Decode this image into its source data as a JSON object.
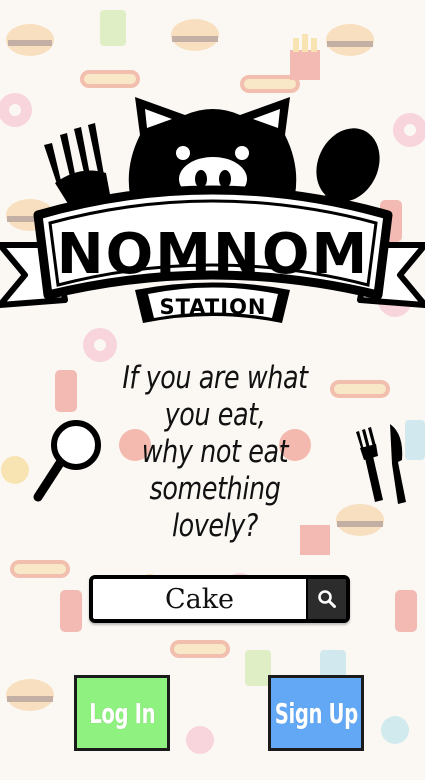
{
  "brand": {
    "name": "NOMNOM",
    "subtitle": "STATION"
  },
  "tagline": {
    "lines": [
      "If you are what",
      "you eat,",
      "why not eat",
      "something lovely?"
    ]
  },
  "search": {
    "value": "Cake"
  },
  "buttons": {
    "login_label": "Log In",
    "signup_label": "Sign Up"
  },
  "colors": {
    "login": "#8ff17f",
    "signup": "#62a8f5",
    "ink": "#000000"
  },
  "icons": {
    "search": "search-icon",
    "magnifier": "magnifier-icon",
    "utensils": "fork-knife-icon"
  }
}
